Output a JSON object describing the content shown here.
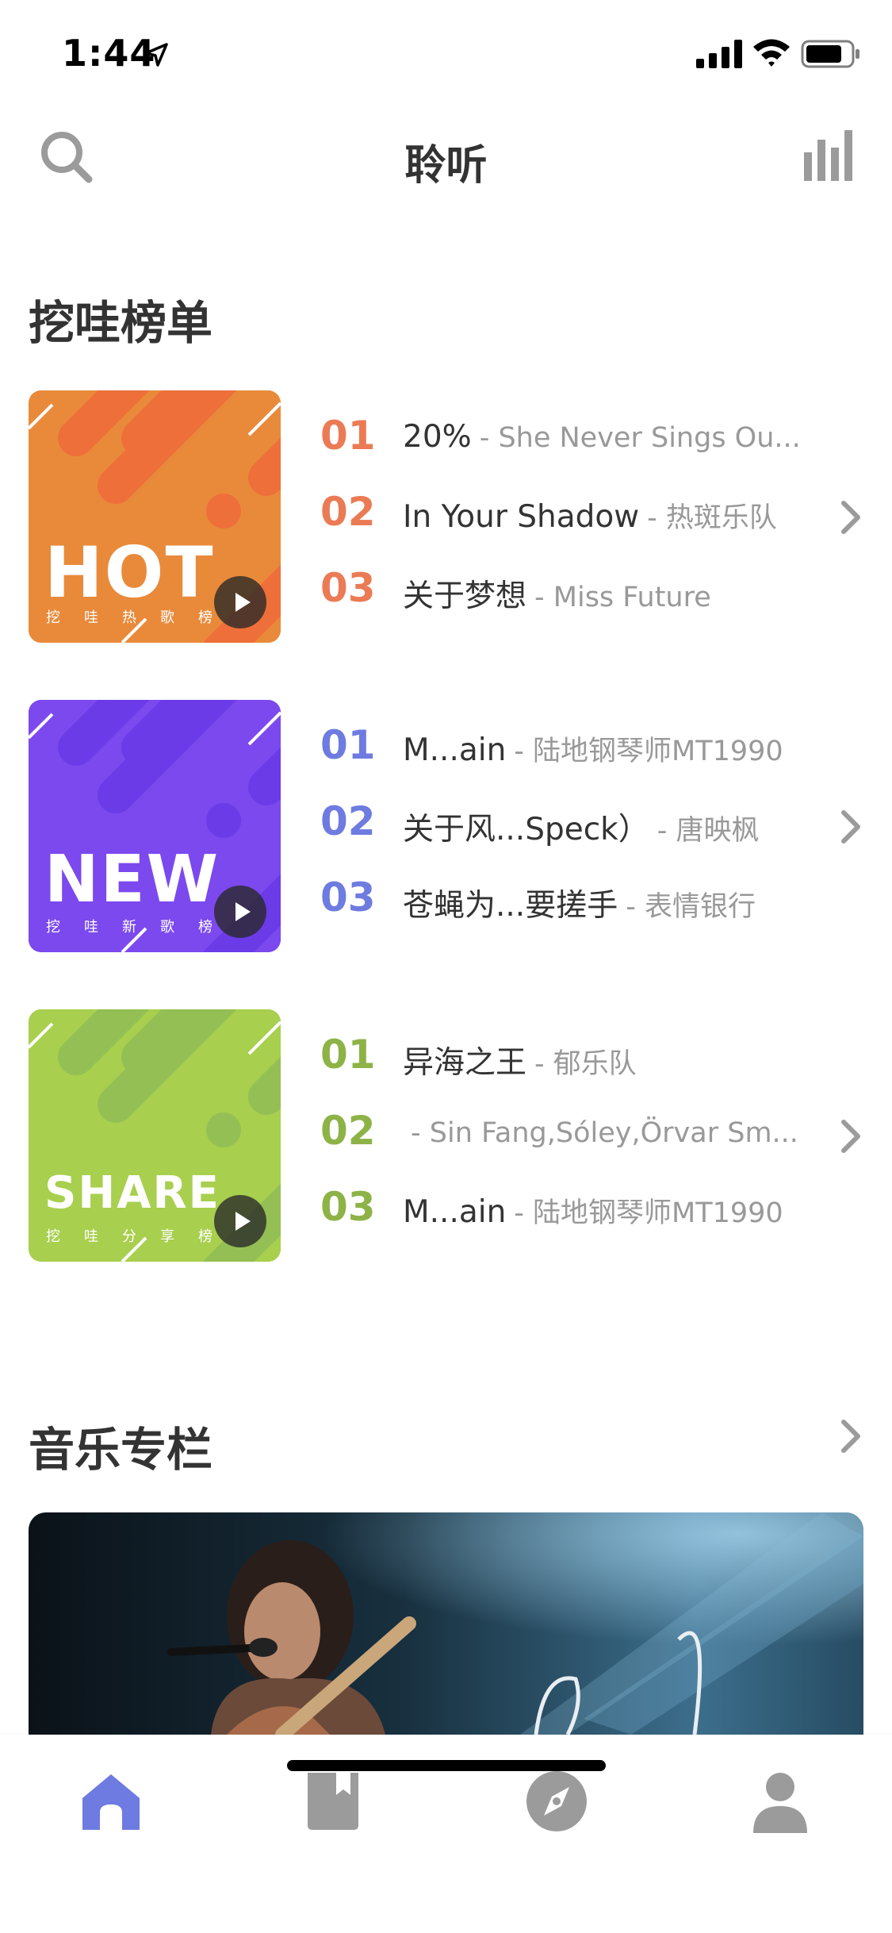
{
  "status_bar": {
    "time": "1:44"
  },
  "nav": {
    "title": "聆听"
  },
  "rank_section": {
    "title": "挖哇榜单",
    "charts": [
      {
        "cover_word": "HOT",
        "cover_sub": "挖哇热歌榜",
        "accent": "#EB7B55",
        "cover_color": "#E98A3A",
        "tracks": [
          {
            "num": "01",
            "title": "20%",
            "artist": "- She Never Sings Ou..."
          },
          {
            "num": "02",
            "title": "In Your Shadow",
            "artist": "- 热斑乐队"
          },
          {
            "num": "03",
            "title": "关于梦想",
            "artist": "- Miss Future"
          }
        ]
      },
      {
        "cover_word": "NEW",
        "cover_sub": "挖哇新歌榜",
        "accent": "#6E7BE0",
        "cover_color": "#7B49EE",
        "tracks": [
          {
            "num": "01",
            "title": "M...ain",
            "artist": "- 陆地钢琴师MT1990"
          },
          {
            "num": "02",
            "title": "关于风...Speck）",
            "artist": "- 唐映枫"
          },
          {
            "num": "03",
            "title": "苍蝇为...要搓手",
            "artist": "- 表情银行"
          }
        ]
      },
      {
        "cover_word": "SHARE",
        "cover_sub": "挖哇分享榜",
        "accent": "#8DB347",
        "cover_color": "#A8CF4E",
        "tracks": [
          {
            "num": "01",
            "title": "异海之王",
            "artist": "- 郁乐队"
          },
          {
            "num": "02",
            "title": "",
            "artist": "- Sin Fang,Sóley,Örvar Sm..."
          },
          {
            "num": "03",
            "title": "M...ain",
            "artist": "- 陆地钢琴师MT1990"
          }
        ]
      }
    ]
  },
  "column_section": {
    "title": "音乐专栏"
  },
  "tab_bar": {
    "tabs": [
      {
        "icon": "home-icon",
        "active": true
      },
      {
        "icon": "book-icon",
        "active": false
      },
      {
        "icon": "compass-icon",
        "active": false
      },
      {
        "icon": "profile-icon",
        "active": false
      }
    ],
    "active_color": "#6E7BE0",
    "inactive_color": "#9B9B9B"
  }
}
